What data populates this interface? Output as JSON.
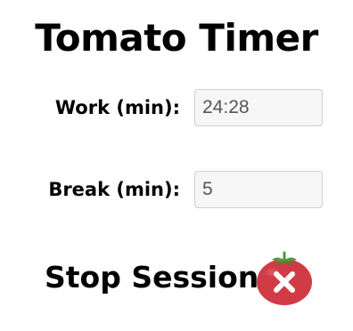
{
  "app": {
    "title": "Tomato Timer"
  },
  "work": {
    "label": "Work (min):",
    "value": "24:28"
  },
  "break": {
    "label": "Break (min):",
    "value": "5"
  },
  "session": {
    "stop_label": "Stop Session",
    "stop_icon": "tomato-close-icon"
  },
  "colors": {
    "tomato_red": "#d13b46",
    "leaf_green": "#4e9a3a",
    "input_bg": "#f6f6f6",
    "input_border": "#cfcfcf"
  }
}
